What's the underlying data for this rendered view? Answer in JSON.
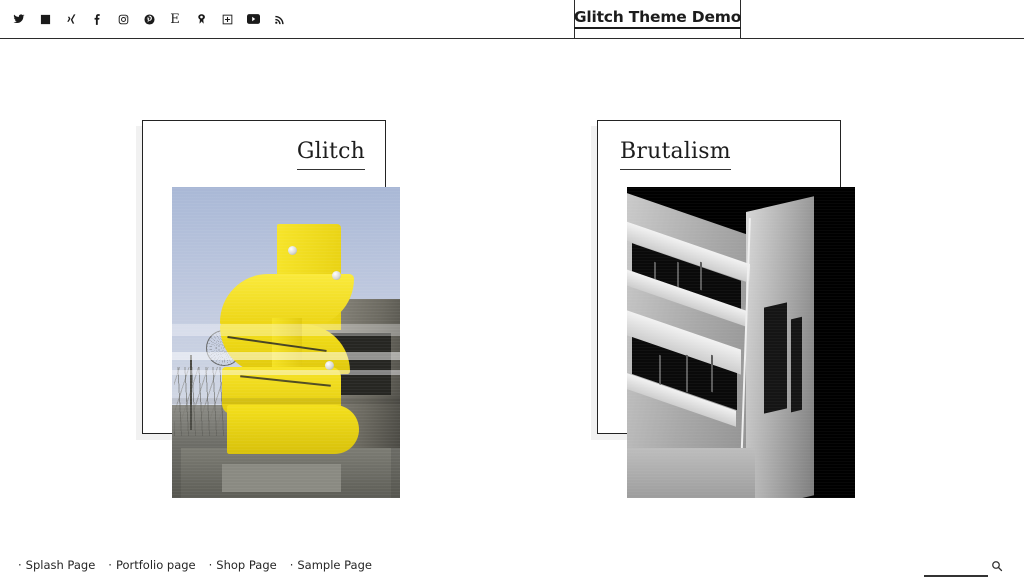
{
  "header": {
    "site_title": "Glitch Theme Demo",
    "social_links": [
      {
        "name": "twitter",
        "label": "Twitter"
      },
      {
        "name": "linkedin",
        "label": "LinkedIn"
      },
      {
        "name": "xing",
        "label": "Xing"
      },
      {
        "name": "facebook",
        "label": "Facebook"
      },
      {
        "name": "instagram",
        "label": "Instagram"
      },
      {
        "name": "pinterest",
        "label": "Pinterest"
      },
      {
        "name": "etsy",
        "label": "Etsy"
      },
      {
        "name": "foursquare",
        "label": "Foursquare"
      },
      {
        "name": "flickr",
        "label": "Flickr"
      },
      {
        "name": "youtube",
        "label": "YouTube"
      },
      {
        "name": "rss",
        "label": "RSS"
      }
    ]
  },
  "main": {
    "posts": [
      {
        "title": "Glitch",
        "title_align": "right",
        "image_alt": "Yellow modular sculpture building against blue sky"
      },
      {
        "title": "Brutalism",
        "title_align": "left",
        "image_alt": "Black and white brutalist concrete building corner"
      }
    ]
  },
  "footer": {
    "links": [
      {
        "label": "Splash Page"
      },
      {
        "label": "Portfolio page"
      },
      {
        "label": "Shop Page"
      },
      {
        "label": "Sample Page"
      }
    ],
    "search": {
      "value": "",
      "placeholder": "",
      "icon": "search-icon"
    }
  },
  "colors": {
    "text": "#1a1a1a",
    "rule": "#2b2b2b",
    "background": "#ffffff",
    "accent_yellow": "#f3df1b",
    "sky_blue": "#b8c4de"
  }
}
